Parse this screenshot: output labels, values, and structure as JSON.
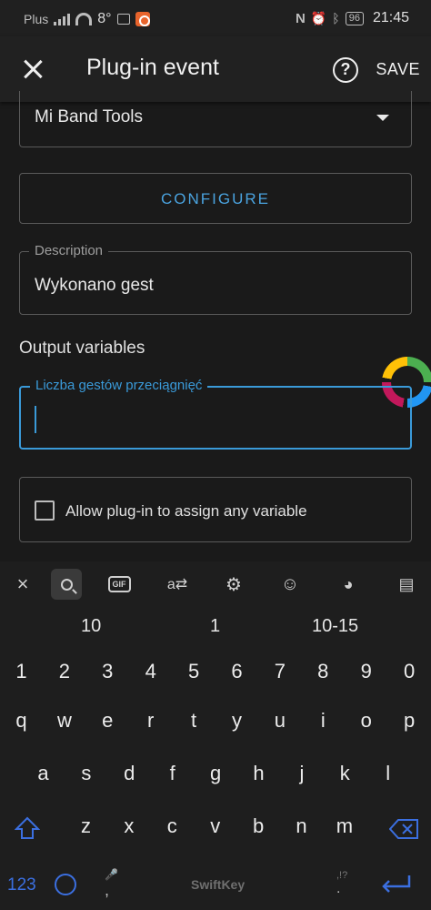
{
  "status": {
    "carrier": "Plus",
    "temperature": "8°",
    "battery": "96",
    "time": "21:45"
  },
  "appbar": {
    "title": "Plug-in event",
    "save_label": "SAVE"
  },
  "form": {
    "plugin_value": "Mi Band Tools",
    "configure_label": "CONFIGURE",
    "description_label": "Description",
    "description_value": "Wykonano gest",
    "output_section": "Output variables",
    "variable_label": "Liczba gestów przeciągnięć",
    "variable_value": "",
    "allow_label": "Allow plug-in to assign any variable",
    "allow_checked": false
  },
  "keyboard": {
    "suggestions": [
      "10",
      "1",
      "10-15"
    ],
    "row_numbers": [
      "1",
      "2",
      "3",
      "4",
      "5",
      "6",
      "7",
      "8",
      "9",
      "0"
    ],
    "row_top": [
      "q",
      "w",
      "e",
      "r",
      "t",
      "y",
      "u",
      "i",
      "o",
      "p"
    ],
    "row_middle": [
      "a",
      "s",
      "d",
      "f",
      "g",
      "h",
      "j",
      "k",
      "l"
    ],
    "row_bottom": [
      "z",
      "x",
      "c",
      "v",
      "b",
      "n",
      "m"
    ],
    "mode_key": "123",
    "comma_key": ",",
    "period_key": ".",
    "period_hint": ",!?",
    "brand": "SwiftKey",
    "gif_label": "GIF",
    "accent_color": "#3a9ad9",
    "key_accent_color": "#3b6fe0"
  }
}
